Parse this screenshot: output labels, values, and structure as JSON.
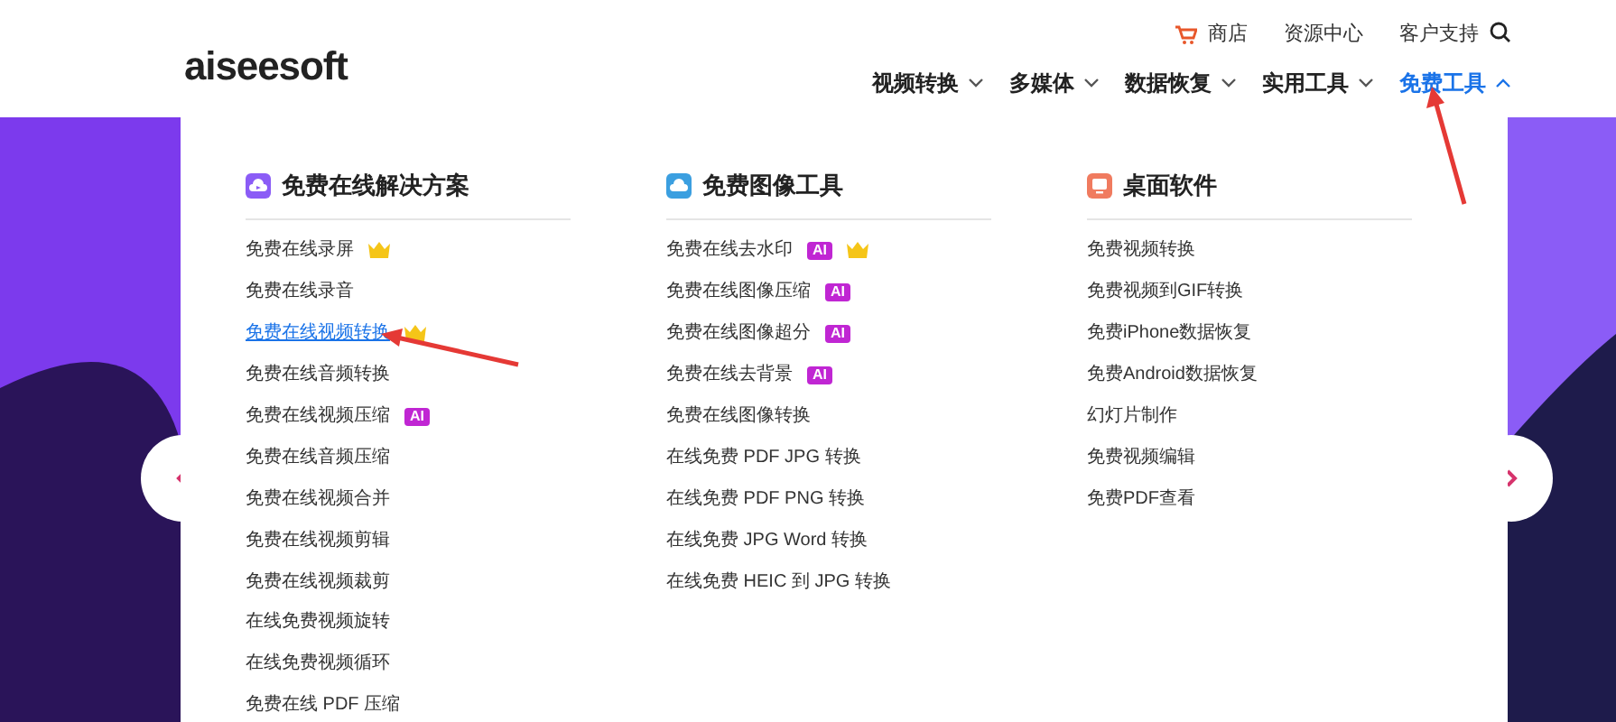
{
  "logo": {
    "text": "aiseesoft"
  },
  "top_links": [
    {
      "kind": "cart",
      "label": "商店"
    },
    {
      "kind": "plain",
      "label": "资源中心"
    },
    {
      "kind": "plain",
      "label": "客户支持"
    }
  ],
  "nav": [
    {
      "label": "视频转换",
      "selected": false
    },
    {
      "label": "多媒体",
      "selected": false
    },
    {
      "label": "数据恢复",
      "selected": false
    },
    {
      "label": "实用工具",
      "selected": false
    },
    {
      "label": "免费工具",
      "selected": true
    }
  ],
  "columns": [
    {
      "title": "免费在线解决方案",
      "items": [
        {
          "label": "免费在线录屏",
          "crown": true,
          "selected": false
        },
        {
          "label": "免费在线录音",
          "crown": false,
          "selected": false
        },
        {
          "label": "免费在线视频转换",
          "crown": true,
          "selected": true
        },
        {
          "label": "免费在线音频转换",
          "crown": false,
          "selected": false
        },
        {
          "label": "免费在线视频压缩",
          "badge": "AI",
          "crown": false,
          "selected": false
        },
        {
          "label": "免费在线音频压缩",
          "crown": false,
          "selected": false
        },
        {
          "label": "免费在线视频合并",
          "crown": false,
          "selected": false
        },
        {
          "label": "免费在线视频剪辑",
          "crown": false,
          "selected": false
        },
        {
          "label": "免费在线视频裁剪",
          "crown": false,
          "selected": false
        },
        {
          "label": "在线免费视频旋转",
          "crown": false,
          "selected": false
        },
        {
          "label": "在线免费视频循环",
          "crown": false,
          "selected": false
        },
        {
          "label": "免费在线 PDF 压缩",
          "crown": false,
          "selected": false
        }
      ]
    },
    {
      "title": "免费图像工具",
      "items": [
        {
          "label": "免费在线去水印",
          "badge": "AI",
          "crown": true,
          "selected": false
        },
        {
          "label": "免费在线图像压缩",
          "badge": "AI",
          "crown": false,
          "selected": false
        },
        {
          "label": "免费在线图像超分",
          "badge": "AI",
          "crown": false,
          "selected": false
        },
        {
          "label": "免费在线去背景",
          "badge": "AI",
          "crown": false,
          "selected": false
        },
        {
          "label": "免费在线图像转换",
          "crown": false,
          "selected": false
        },
        {
          "label": "在线免费 PDF JPG 转换",
          "crown": false,
          "selected": false
        },
        {
          "label": "在线免费 PDF PNG 转换",
          "crown": false,
          "selected": false
        },
        {
          "label": "在线免费 JPG Word 转换",
          "crown": false,
          "selected": false
        },
        {
          "label": "在线免费 HEIC 到 JPG 转换",
          "crown": false,
          "selected": false
        }
      ]
    },
    {
      "title": "桌面软件",
      "items": [
        {
          "label": "免费视频转换",
          "crown": false,
          "selected": false
        },
        {
          "label": "免费视频到GIF转换",
          "crown": false,
          "selected": false
        },
        {
          "label": "免费iPhone数据恢复",
          "crown": false,
          "selected": false
        },
        {
          "label": "免费Android数据恢复",
          "crown": false,
          "selected": false
        },
        {
          "label": "幻灯片制作",
          "crown": false,
          "selected": false
        },
        {
          "label": "免费视频编辑",
          "crown": false,
          "selected": false
        },
        {
          "label": "免费PDF查看",
          "crown": false,
          "selected": false
        }
      ]
    }
  ]
}
